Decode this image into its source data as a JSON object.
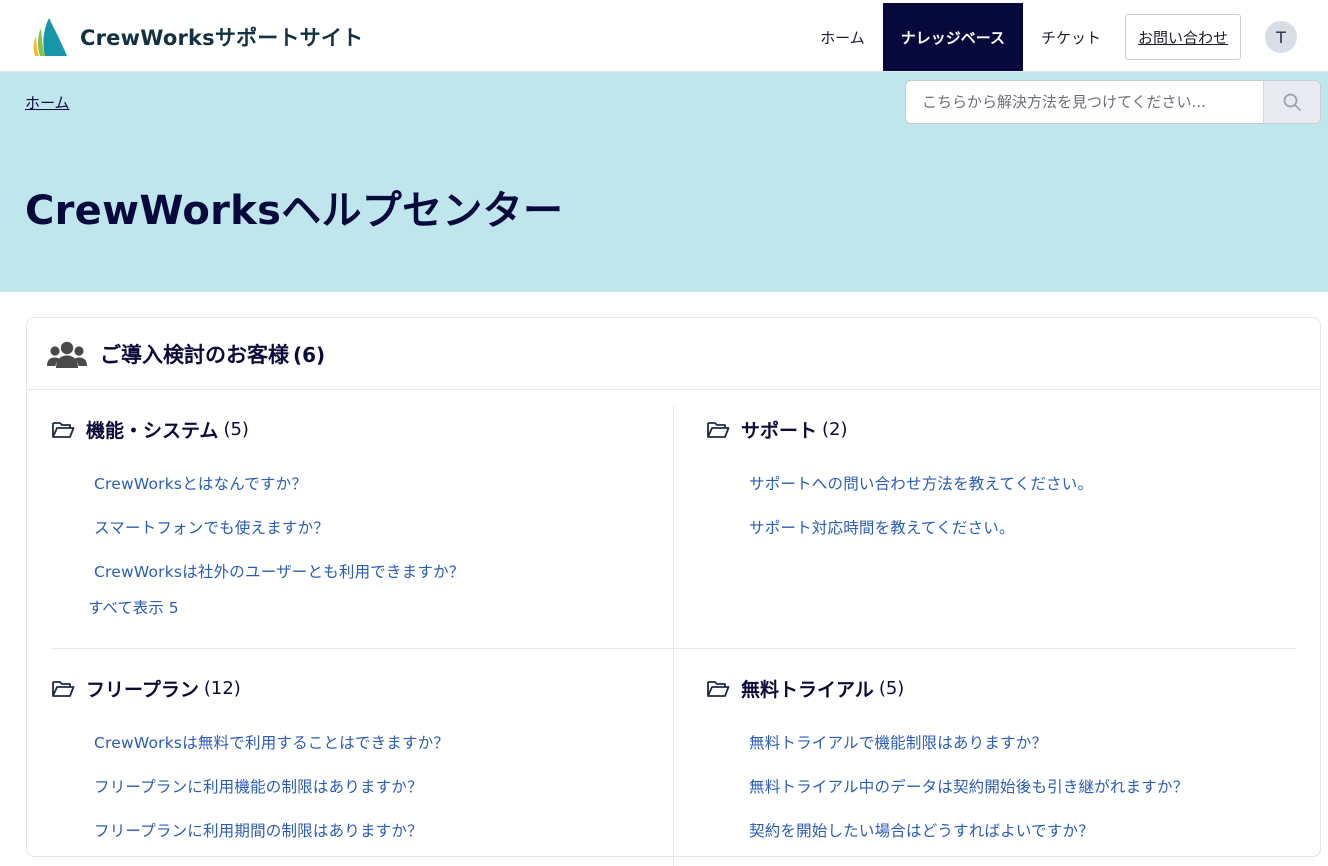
{
  "header": {
    "site_name": "CrewWorksサポートサイト",
    "nav": [
      {
        "label": "ホーム",
        "active": false
      },
      {
        "label": "ナレッジベース",
        "active": true
      },
      {
        "label": "チケット",
        "active": false
      }
    ],
    "contact_label": "お問い合わせ",
    "avatar_initial": "T"
  },
  "hero": {
    "breadcrumb": "ホーム",
    "search_placeholder": "こちらから解決方法を見つけてください...",
    "title": "CrewWorksヘルプセンター"
  },
  "category": {
    "title": "ご導入検討のお客様",
    "count": "(6)",
    "sections": [
      {
        "title": "機能・システム",
        "count": "(5)",
        "articles": [
          "CrewWorksとはなんですか？",
          "スマートフォンでも使えますか？",
          "CrewWorksは社外のユーザーとも利用できますか？"
        ],
        "show_all": "すべて表示 5"
      },
      {
        "title": "サポート",
        "count": "(2)",
        "articles": [
          "サポートへの問い合わせ方法を教えてください。",
          "サポート対応時間を教えてください。"
        ]
      },
      {
        "title": "フリープラン",
        "count": "(12)",
        "articles": [
          "CrewWorksは無料で利用することはできますか？",
          "フリープランに利用機能の制限はありますか？",
          "フリープランに利用期間の制限はありますか？"
        ]
      },
      {
        "title": "無料トライアル",
        "count": "(5)",
        "articles": [
          "無料トライアルで機能制限はありますか？",
          "無料トライアル中のデータは契約開始後も引き継がれますか？",
          "契約を開始したい場合はどうすればよいですか？"
        ]
      }
    ]
  },
  "colors": {
    "hero_bg": "#bfe6ed",
    "nav_active_bg": "#07083c",
    "link": "#2b5cb8",
    "heading": "#0b0b3b"
  },
  "icons": {
    "logo": "sail-logo-icon",
    "search": "search-icon",
    "category": "users-group-icon",
    "section": "folder-open-icon"
  }
}
